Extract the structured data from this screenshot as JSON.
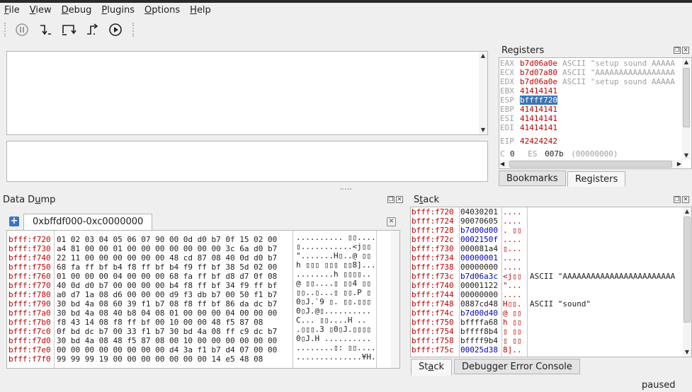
{
  "menu": [
    "File",
    "View",
    "Debug",
    "Plugins",
    "Options",
    "Help"
  ],
  "menu_underline": [
    "F",
    "V",
    "D",
    "P",
    "O",
    "H"
  ],
  "toolbar": {
    "icons": [
      "pause-icon",
      "step-into-icon",
      "step-over-icon",
      "step-out-icon",
      "run-icon"
    ]
  },
  "registers": {
    "title": "Registers",
    "rows": [
      {
        "name": "EAX",
        "value": "b7d06a0e",
        "comment": "ASCII \"setup sound AAAAA"
      },
      {
        "name": "ECX",
        "value": "b7d07a80",
        "comment": "ASCII \"AAAAAAAAAAAAAAAAA"
      },
      {
        "name": "EDX",
        "value": "b7d06a0e",
        "comment": "ASCII \"setup sound AAAAA"
      },
      {
        "name": "EBX",
        "value": "41414141",
        "comment": ""
      },
      {
        "name": "ESP",
        "value": "bffff720",
        "comment": ""
      },
      {
        "name": "EBP",
        "value": "41414141",
        "comment": ""
      },
      {
        "name": "ESI",
        "value": "41414141",
        "comment": ""
      },
      {
        "name": "EDI",
        "value": "41414141",
        "comment": ""
      },
      {
        "name": "EIP",
        "value": "42424242",
        "comment": ""
      }
    ],
    "flags_line": {
      "c_label": "C",
      "c_value": "0",
      "es_label": "ES",
      "es_value": "007b",
      "es_comment": "(00000000)"
    },
    "tabs": [
      "Bookmarks",
      "Registers"
    ],
    "active_tab": "Registers"
  },
  "data_dump": {
    "title": "Data Dump",
    "tab_label": "0xbffdf000-0xc0000000",
    "rows": [
      {
        "addr": "bfff:f720",
        "hex": "01 02 03 04 05 06 07 90 00 0d d0 b7 0f 15 02 00",
        "ascii": ".......... ▯▯...."
      },
      {
        "addr": "bfff:f730",
        "hex": "a4 81 00 00 01 00 00 00 00 00 00 00 3c 6a d0 b7",
        "ascii": "▯...........<j▯▯"
      },
      {
        "addr": "bfff:f740",
        "hex": "22 11 00 00 00 00 00 00 48 cd 87 08 40 0d d0 b7",
        "ascii": "\".......H▯..@ ▯▯"
      },
      {
        "addr": "bfff:f750",
        "hex": "68 fa ff bf b4 f8 ff bf b4 f9 ff bf 38 5d 02 00",
        "ascii": "h ▯▯▯ ▯▯▯ ▯▯8]..."
      },
      {
        "addr": "bfff:f760",
        "hex": "01 00 00 00 04 00 00 00 68 fa ff bf d8 d7 0f 08",
        "ascii": "........h ▯▯▯▯.."
      },
      {
        "addr": "bfff:f770",
        "hex": "40 0d d0 b7 00 00 00 00 b4 f8 ff bf 34 f9 ff bf",
        "ascii": "@ ▯▯....▯ ▯▯4 ▯▯"
      },
      {
        "addr": "bfff:f780",
        "hex": "a0 d7 1a 08 d6 00 00 00 d9 f3 db b7 00 50 f1 b7",
        "ascii": "▯▯..▯...▯ ▯▯.P ▯"
      },
      {
        "addr": "bfff:f790",
        "hex": "30 bd 4a 08 60 39 f1 b7 08 f8 ff bf 86 da dc b7",
        "ascii": "0▯J.`9 ▯. ▯▯.▯▯▯"
      },
      {
        "addr": "bfff:f7a0",
        "hex": "30 bd 4a 08 40 b8 04 08 01 00 00 00 04 00 00 00",
        "ascii": "0▯J.@▯.........."
      },
      {
        "addr": "bfff:f7b0",
        "hex": "f8 43 14 08 f8 ff bf 00 10 00 00 48 f5 87 08",
        "ascii": " C... ▯▯....H .."
      },
      {
        "addr": "bfff:f7c0",
        "hex": "0f bd dc b7 00 33 f1 b7 30 bd 4a 08 ff c9 dc b7",
        "ascii": ".▯▯▯.3 ▯0▯J.▯▯▯▯"
      },
      {
        "addr": "bfff:f7d0",
        "hex": "30 bd 4a 08 48 f5 87 08 00 10 00 00 00 00 00 00",
        "ascii": "0▯J.H .........."
      },
      {
        "addr": "bfff:f7e0",
        "hex": "00 00 00 00 00 00 00 00 d4 3a f1 b7 d4 07 00 00",
        "ascii": "........▯: ▯▯...."
      },
      {
        "addr": "bfff:f7f0",
        "hex": "99 99 99 19 00 00 00 00 00 00 00 14 e5 48 08",
        "ascii": "..............¥H."
      }
    ]
  },
  "stack": {
    "title": "Stack",
    "rows": [
      {
        "addr": "bfff:f720",
        "value": "04030201",
        "ascii": "....",
        "comment": ""
      },
      {
        "addr": "bfff:f724",
        "value": "90070605",
        "ascii": "....",
        "comment": ""
      },
      {
        "addr": "bfff:f728",
        "value": "b7d00d00",
        "ascii": ". ▯▯",
        "comment": ""
      },
      {
        "addr": "bfff:f72c",
        "value": "0002150f",
        "ascii": "....",
        "comment": ""
      },
      {
        "addr": "bfff:f730",
        "value": "000081a4",
        "ascii": "▯...",
        "comment": ""
      },
      {
        "addr": "bfff:f734",
        "value": "00000001",
        "ascii": "....",
        "comment": ""
      },
      {
        "addr": "bfff:f738",
        "value": "00000000",
        "ascii": "....",
        "comment": ""
      },
      {
        "addr": "bfff:f73c",
        "value": "b7d06a3c",
        "ascii": "<j▯▯",
        "comment": "ASCII \"AAAAAAAAAAAAAAAAAAAAAAAA"
      },
      {
        "addr": "bfff:f740",
        "value": "00001122",
        "ascii": "\"...",
        "comment": ""
      },
      {
        "addr": "bfff:f744",
        "value": "00000000",
        "ascii": "....",
        "comment": ""
      },
      {
        "addr": "bfff:f748",
        "value": "0887cd48",
        "ascii": "H▯▯.",
        "comment": "ASCII \"sound\""
      },
      {
        "addr": "bfff:f74c",
        "value": "b7d00d40",
        "ascii": "@ ▯▯",
        "comment": ""
      },
      {
        "addr": "bfff:f750",
        "value": "bffffa68",
        "ascii": "h ▯▯",
        "comment": ""
      },
      {
        "addr": "bfff:f754",
        "value": "bffff8b4",
        "ascii": "▯ ▯▯",
        "comment": ""
      },
      {
        "addr": "bfff:f758",
        "value": "bffff9b4",
        "ascii": "▯ ▯▯",
        "comment": ""
      },
      {
        "addr": "bfff:f75c",
        "value": "00025d38",
        "ascii": "8]..",
        "comment": ""
      }
    ],
    "tabs": [
      "Stack",
      "Debugger Error Console"
    ],
    "active_tab": "Stack"
  },
  "status": "paused",
  "colors": {
    "address": "#c00000",
    "highlight": "#3b74b4",
    "blue": "#0000c0",
    "gray": "#a0a0a0"
  }
}
